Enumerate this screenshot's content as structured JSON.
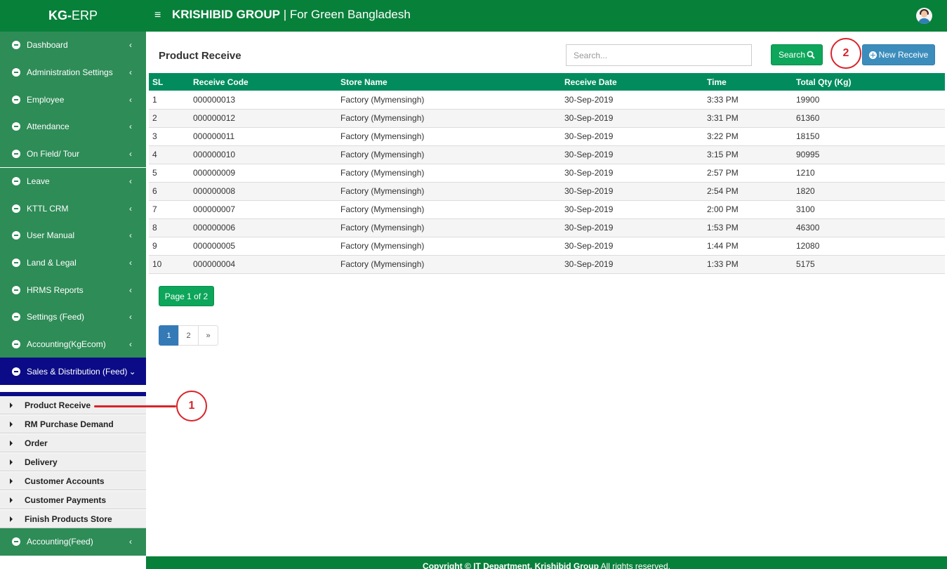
{
  "header": {
    "brand_bold": "KG-",
    "brand_rest": "ERP",
    "menu_icon": "≡",
    "group_bold": "KRISHIBID GROUP",
    "group_rest": " | For Green Bangladesh"
  },
  "sidebar": {
    "items": [
      {
        "label": "Dashboard"
      },
      {
        "label": "Administration Settings"
      },
      {
        "label": "Employee"
      },
      {
        "label": "Attendance"
      },
      {
        "label": "On Field/ Tour"
      },
      {
        "label": "Leave"
      },
      {
        "label": "KTTL CRM"
      },
      {
        "label": "User Manual"
      },
      {
        "label": "Land & Legal"
      },
      {
        "label": "HRMS Reports"
      },
      {
        "label": "Settings (Feed)"
      },
      {
        "label": "Accounting(KgEcom)"
      },
      {
        "label": "Sales & Distribution (Feed)"
      }
    ],
    "submenu": [
      {
        "label": "Product Receive"
      },
      {
        "label": "RM Purchase Demand"
      },
      {
        "label": "Order"
      },
      {
        "label": "Delivery"
      },
      {
        "label": "Customer Accounts"
      },
      {
        "label": "Customer Payments"
      },
      {
        "label": "Finish Products Store"
      }
    ],
    "after": {
      "label": "Accounting(Feed)"
    },
    "chevron_left": "‹",
    "chevron_down": "⌄"
  },
  "main": {
    "title": "Product Receive",
    "search_placeholder": "Search...",
    "search_button": "Search",
    "search_icon_glyph": "🔍",
    "new_button": "New Receive",
    "table": {
      "headers": [
        "SL",
        "Receive Code",
        "Store Name",
        "Receive Date",
        "Time",
        "Total Qty (Kg)"
      ],
      "rows": [
        [
          "1",
          "000000013",
          "Factory (Mymensingh)",
          "30-Sep-2019",
          "3:33 PM",
          "19900"
        ],
        [
          "2",
          "000000012",
          "Factory (Mymensingh)",
          "30-Sep-2019",
          "3:31 PM",
          "61360"
        ],
        [
          "3",
          "000000011",
          "Factory (Mymensingh)",
          "30-Sep-2019",
          "3:22 PM",
          "18150"
        ],
        [
          "4",
          "000000010",
          "Factory (Mymensingh)",
          "30-Sep-2019",
          "3:15 PM",
          "90995"
        ],
        [
          "5",
          "000000009",
          "Factory (Mymensingh)",
          "30-Sep-2019",
          "2:57 PM",
          "1210"
        ],
        [
          "6",
          "000000008",
          "Factory (Mymensingh)",
          "30-Sep-2019",
          "2:54 PM",
          "1820"
        ],
        [
          "7",
          "000000007",
          "Factory (Mymensingh)",
          "30-Sep-2019",
          "2:00 PM",
          "3100"
        ],
        [
          "8",
          "000000006",
          "Factory (Mymensingh)",
          "30-Sep-2019",
          "1:53 PM",
          "46300"
        ],
        [
          "9",
          "000000005",
          "Factory (Mymensingh)",
          "30-Sep-2019",
          "1:44 PM",
          "12080"
        ],
        [
          "10",
          "000000004",
          "Factory (Mymensingh)",
          "30-Sep-2019",
          "1:33 PM",
          "5175"
        ]
      ]
    },
    "page_badge": "Page 1 of 2",
    "pager": [
      "1",
      "2",
      "»"
    ]
  },
  "annotations": {
    "one": "1",
    "two": "2"
  },
  "footer": {
    "bold": "Copyright © IT Department, Krishibid Group",
    "light": " All rights reserved."
  },
  "colors": {
    "header_green": "#07803a",
    "sidebar_green": "#2e8c57",
    "active_navy": "#0b0b87",
    "table_header": "#028c5e",
    "search_green": "#0da65a",
    "new_blue": "#3c8dbc",
    "annotation_red": "#d9232a"
  }
}
